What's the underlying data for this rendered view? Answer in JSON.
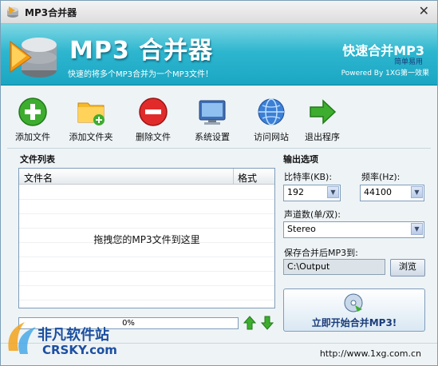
{
  "window": {
    "title": "MP3合并器",
    "close_glyph": "✕"
  },
  "banner": {
    "app_name": "MP3 合并器",
    "subtitle": "快速的将多个MP3合并为一个MP3文件！",
    "slogan": "快速合并MP3",
    "slogan_sub": "简单易用",
    "powered_by": "Powered By 1XG第一效果"
  },
  "toolbar": {
    "add_file": "添加文件",
    "add_folder": "添加文件夹",
    "delete_file": "删除文件",
    "settings": "系统设置",
    "visit_site": "访问网站",
    "exit": "退出程序"
  },
  "file_list": {
    "section_title": "文件列表",
    "col_name": "文件名",
    "col_format": "格式",
    "hint": "拖拽您的MP3文件到这里"
  },
  "output": {
    "section_title": "输出选项",
    "bitrate_label": "比特率(KB):",
    "bitrate_value": "192",
    "samplerate_label": "频率(Hz):",
    "samplerate_value": "44100",
    "channels_label": "声道数(单/双):",
    "channels_value": "Stereo",
    "save_label": "保存合并后MP3到:",
    "save_path": "C:\\Output",
    "browse_label": "浏览",
    "start_label": "立即开始合并MP3!"
  },
  "progress": {
    "text": "0%",
    "value": 0
  },
  "status": {
    "url": "http://www.1xg.com.cn"
  },
  "watermark": {
    "title": "非凡软件站",
    "sub": "CRSKY.com"
  },
  "colors": {
    "banner": "#2eb6cf",
    "accent": "#1b3d7a"
  }
}
